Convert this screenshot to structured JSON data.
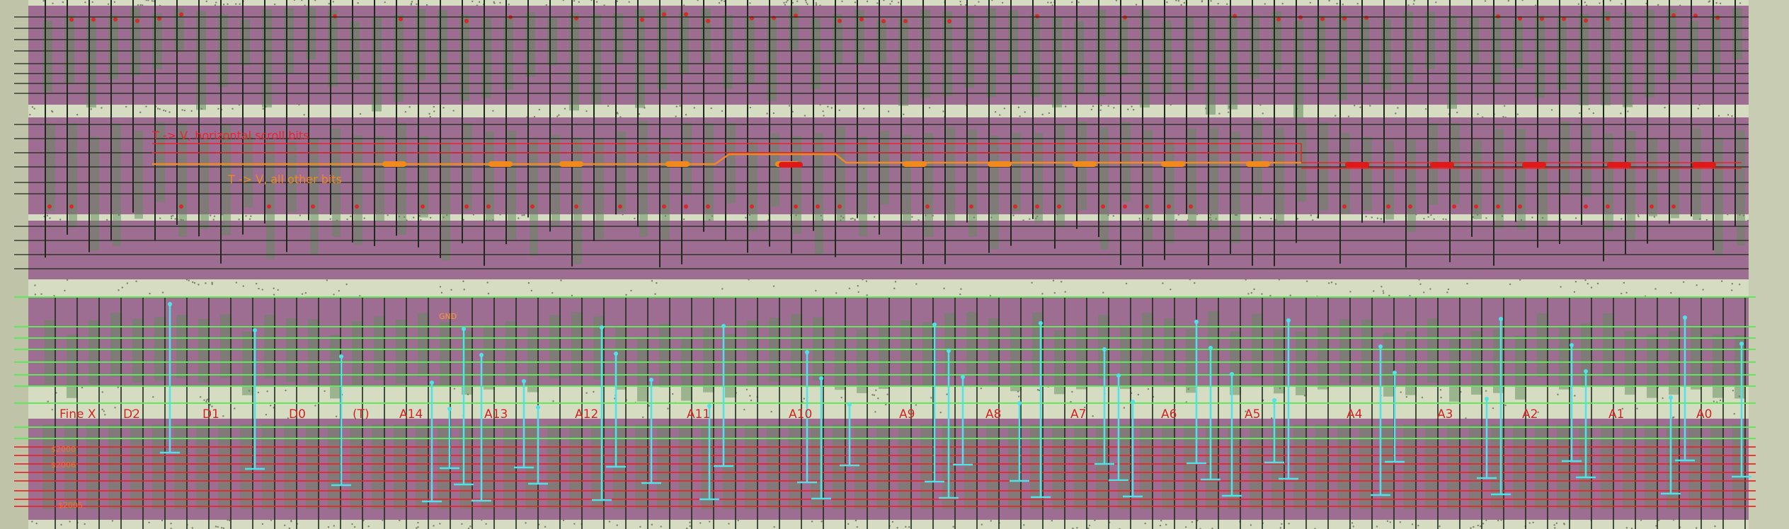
{
  "colors": {
    "substrate": "#9e6d92",
    "metal_band": "#d6dcc2",
    "poly": "#5f8a5c",
    "wire_dark": "#1f2a1c",
    "annotation_red": "#e8262a",
    "annotation_orange": "#f08a1e",
    "net_green": "#5ee85a",
    "net_cyan": "#4fe3e8",
    "label_red": "#d62020"
  },
  "annotations": {
    "red_path_label": "T -> V, horizontal scroll bits",
    "orange_path_label": "T -> V, all other bits"
  },
  "gnd_label": "GND",
  "bit_labels": [
    "Fine X",
    "D2",
    "D1",
    "D0",
    "(T)",
    "A14",
    "A13",
    "A12",
    "A11",
    "A10",
    "A9",
    "A8",
    "A7",
    "A6",
    "A5",
    "A4",
    "A3",
    "A2",
    "A1",
    "A0"
  ],
  "register_labels": {
    "upper": "$2000",
    "lower": "$2006",
    "bottom": "$2005"
  }
}
